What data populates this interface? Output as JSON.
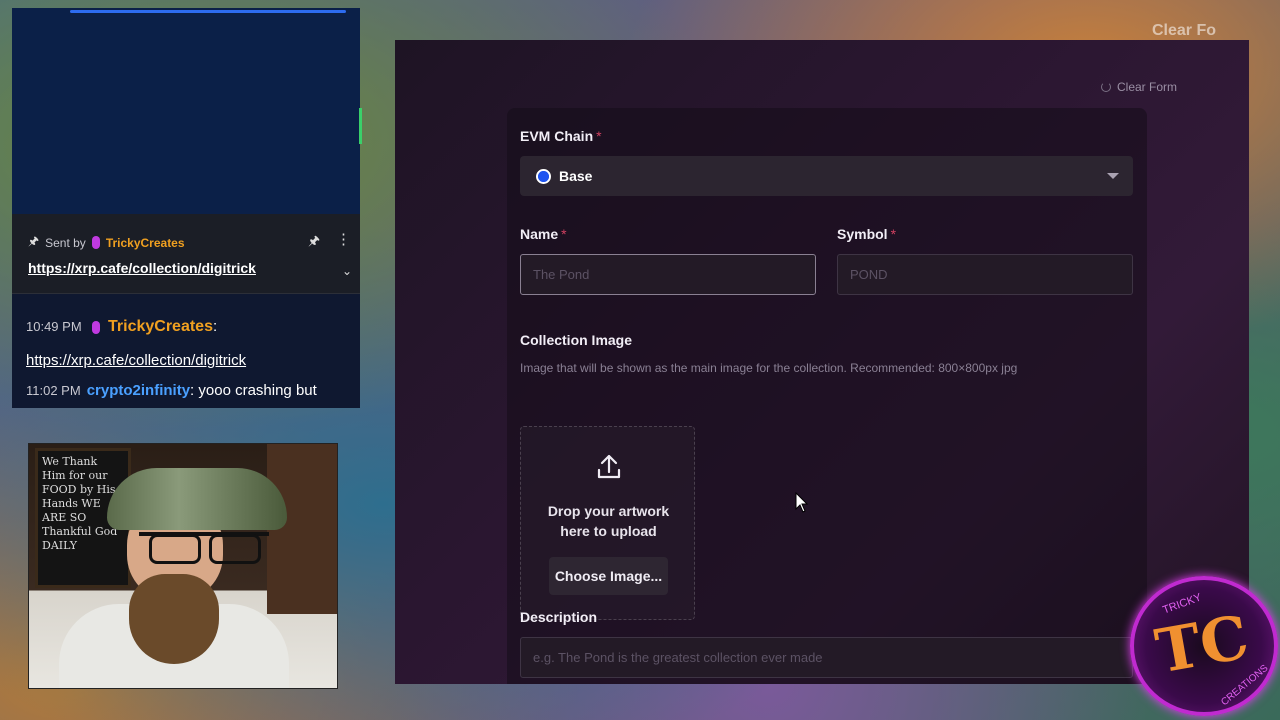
{
  "chat": {
    "pinned": {
      "sent_by_label": "Sent by",
      "author": "TrickyCreates",
      "link": "https://xrp.cafe/collection/digitrick"
    },
    "messages": [
      {
        "time": "10:49 PM",
        "user": "TrickyCreates",
        "text": ":",
        "link": "https://xrp.cafe/collection/digitrick"
      },
      {
        "time": "11:02 PM",
        "user": "crypto2infinity",
        "text": ": yooo crashing but"
      }
    ]
  },
  "webcam": {
    "sign_text": "We Thank Him for our FOOD by His Hands WE ARE SO Thankful God DAILY"
  },
  "background": {
    "clear_text": "Clear Fo"
  },
  "form": {
    "clear_form": "Clear Form",
    "evm_chain": {
      "label": "EVM Chain",
      "required": "*",
      "value": "Base",
      "icon": "base-chain-icon"
    },
    "name": {
      "label": "Name",
      "required": "*",
      "placeholder": "The Pond"
    },
    "symbol": {
      "label": "Symbol",
      "required": "*",
      "placeholder": "POND"
    },
    "collection_image": {
      "label": "Collection Image",
      "hint": "Image that will be shown as the main image for the collection. Recommended: 800×800px jpg",
      "drop_text": "Drop your artwork here to upload",
      "choose_button": "Choose Image..."
    },
    "description": {
      "label": "Description",
      "placeholder": "e.g. The Pond is the greatest collection ever made"
    }
  },
  "logo": {
    "text_top": "TRICKY",
    "text_bottom": "CREATIONS",
    "monogram": "TC"
  },
  "colors": {
    "accent_required": "#d04060",
    "chain_blue": "#2055f0",
    "chat_author": "#f0a020",
    "chat_user2": "#4aa0ff"
  }
}
